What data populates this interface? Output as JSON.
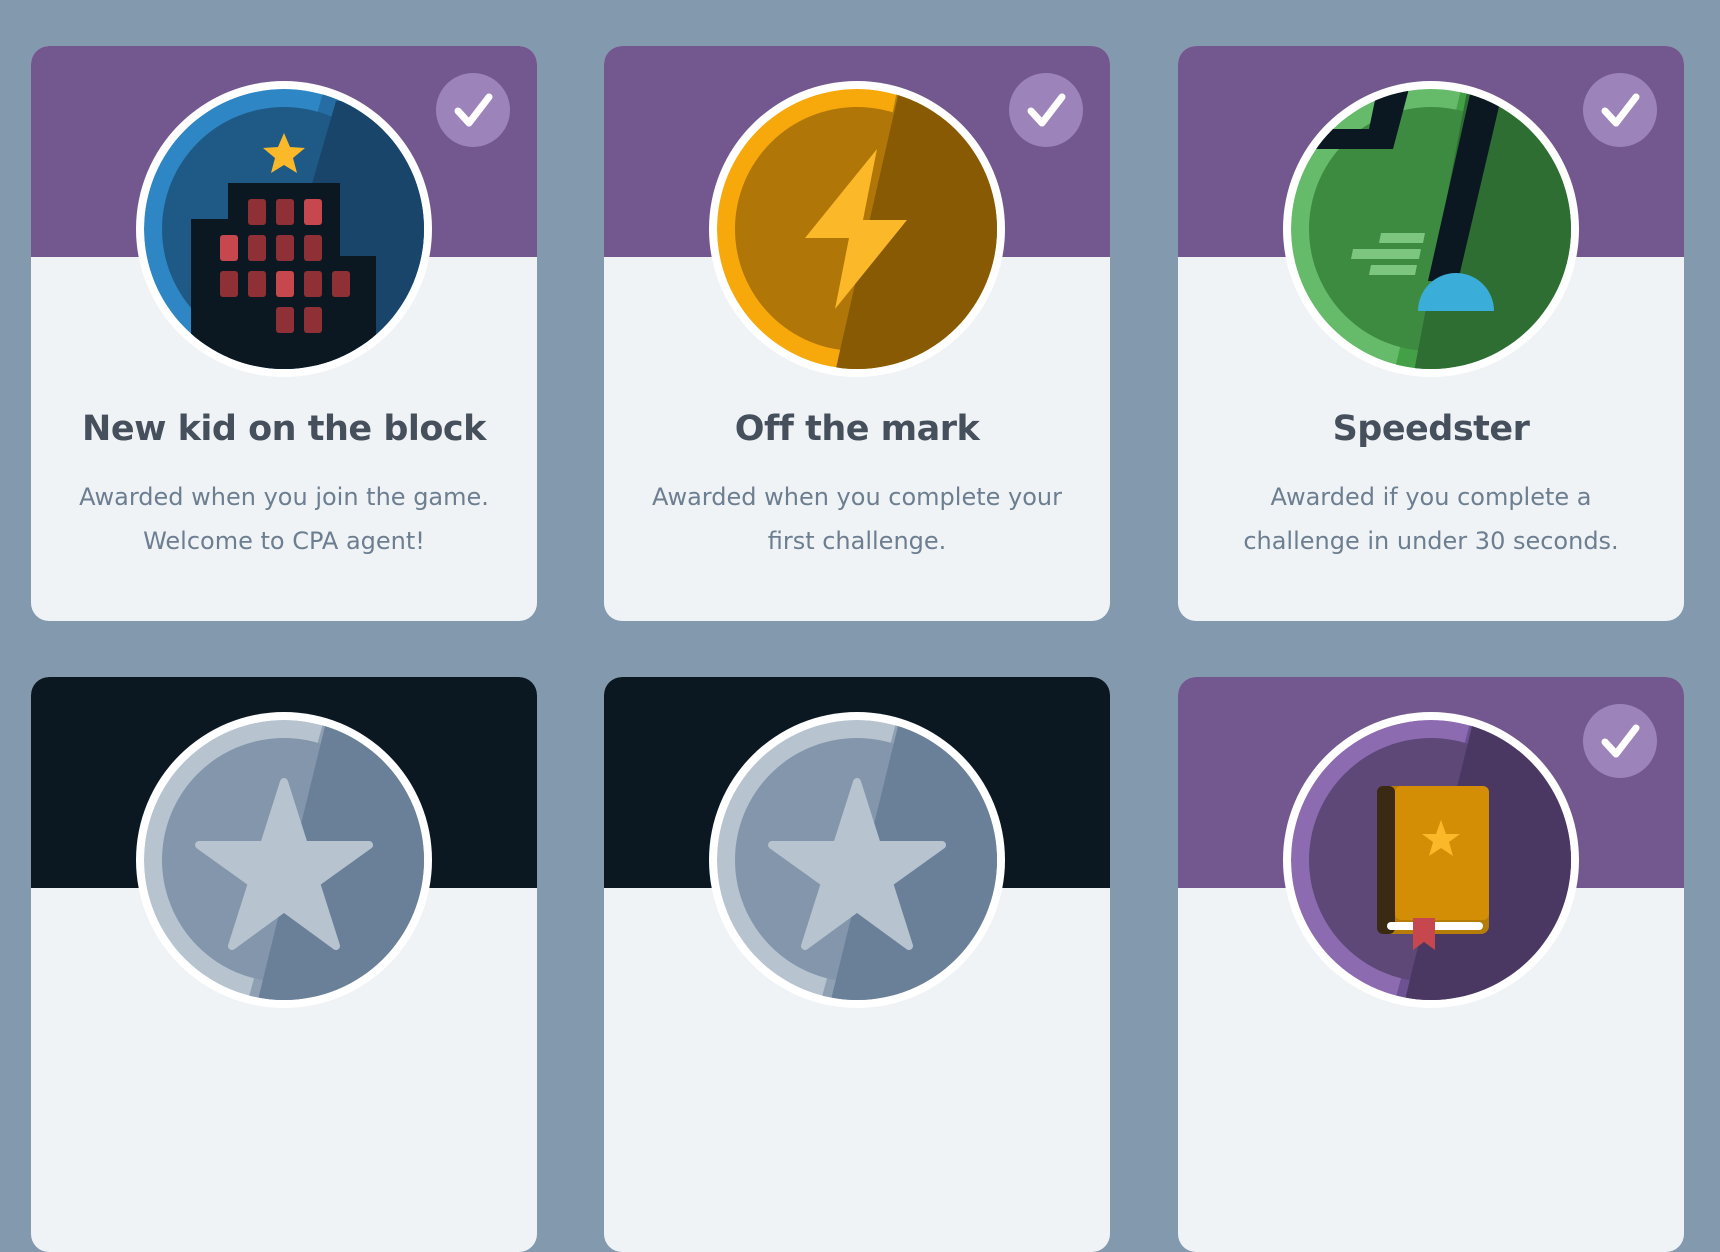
{
  "achievements": [
    {
      "title": "New kid on the block",
      "description": "Awarded when you join the game. Welcome to CPA agent!",
      "status": "earned",
      "icon": "city-building-icon"
    },
    {
      "title": "Off the mark",
      "description": "Awarded when you complete your first challenge.",
      "status": "earned",
      "icon": "lightning-bolt-icon"
    },
    {
      "title": "Speedster",
      "description": "Awarded if you complete a challenge in under 30 seconds.",
      "status": "earned",
      "icon": "stopwatch-speed-icon"
    },
    {
      "title": "",
      "description": "",
      "status": "locked",
      "icon": "star-icon"
    },
    {
      "title": "",
      "description": "",
      "status": "locked",
      "icon": "star-icon"
    },
    {
      "title": "",
      "description": "",
      "status": "earned",
      "icon": "book-icon"
    }
  ],
  "colors": {
    "page_background": "#8399ae",
    "earned_band": "#72588f",
    "locked_band": "#0b1822",
    "card_background": "#eff3f6",
    "check_badge": "#9c83b9",
    "title_text": "#46505d",
    "description_text": "#6c7e90"
  }
}
